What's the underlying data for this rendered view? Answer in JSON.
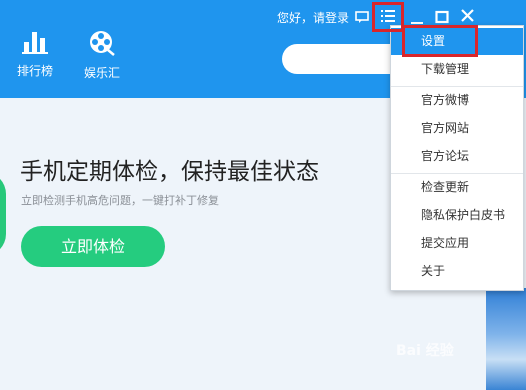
{
  "header": {
    "nav": [
      {
        "label": "排行榜",
        "icon": "bar-chart-icon"
      },
      {
        "label": "娱乐汇",
        "icon": "film-reel-icon"
      }
    ],
    "greeting": "您好，请登录",
    "icons": [
      "message-icon",
      "menu-list-icon",
      "minimize-icon",
      "maximize-icon",
      "close-icon"
    ]
  },
  "main": {
    "headline": "手机定期体检，保持最佳状态",
    "subline": "立即检测手机高危问题，一键打补丁修复",
    "check_button": "立即体检"
  },
  "menu": {
    "items": [
      "设置",
      "下载管理",
      "官方微博",
      "官方网站",
      "官方论坛",
      "检查更新",
      "隐私保护白皮书",
      "提交应用",
      "关于"
    ],
    "active_index": 0
  },
  "watermark": "Bai 经验",
  "colors": {
    "brand_blue": "#1f95ee",
    "green": "#25cc7f",
    "highlight_red": "#d9262b"
  }
}
